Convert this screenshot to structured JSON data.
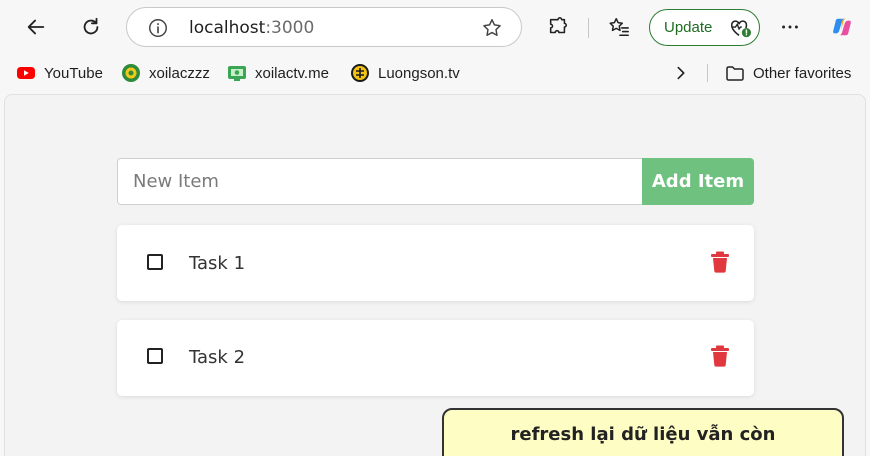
{
  "browser": {
    "url_host": "localhost",
    "url_port": ":3000",
    "update_label": "Update"
  },
  "bookmarks": [
    {
      "label": "YouTube",
      "icon": "youtube-icon"
    },
    {
      "label": "xoilaczzz",
      "icon": "xoilac-icon"
    },
    {
      "label": "xoilactv.me",
      "icon": "xoilactv-icon"
    },
    {
      "label": "Luongson.tv",
      "icon": "luongson-icon"
    }
  ],
  "other_favorites": "Other favorites",
  "app": {
    "input_placeholder": "New Item",
    "input_value": "",
    "add_button": "Add Item",
    "tasks": [
      {
        "text": "Task 1",
        "checked": false
      },
      {
        "text": "Task 2",
        "checked": false
      }
    ],
    "note": "refresh lại dữ liệu vẫn còn"
  },
  "colors": {
    "add_button": "#6fc17f",
    "delete_icon": "#e0383e",
    "note_bg": "#fefdc4",
    "update_border": "#2f7d32"
  }
}
